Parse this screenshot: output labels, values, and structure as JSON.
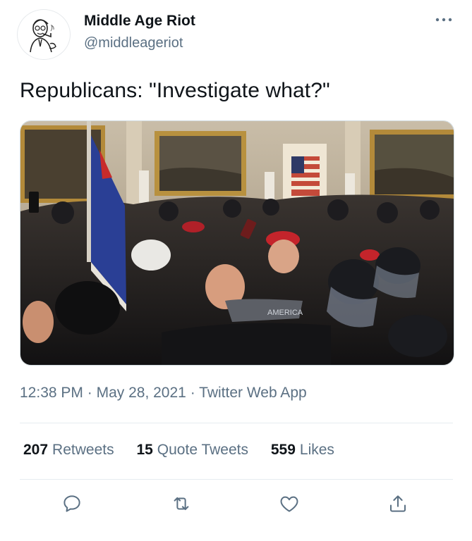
{
  "author": {
    "display_name": "Middle Age Riot",
    "handle": "@middleageriot",
    "avatar_icon": "cartoon-man-pipe-avatar"
  },
  "header": {
    "more_icon": "more-dots-icon"
  },
  "tweet": {
    "text": "Republicans: \"Investigate what?\""
  },
  "media": {
    "description_icon": "photo-image",
    "flag_text": "AMERICA"
  },
  "meta": {
    "time": "12:38 PM",
    "separator": "·",
    "date": "May 28, 2021",
    "source": "Twitter Web App"
  },
  "stats": {
    "retweets_count": "207",
    "retweets_label": "Retweets",
    "quotes_count": "15",
    "quotes_label": "Quote Tweets",
    "likes_count": "559",
    "likes_label": "Likes"
  },
  "actions": {
    "reply_icon": "reply-icon",
    "retweet_icon": "retweet-icon",
    "like_icon": "heart-icon",
    "share_icon": "share-icon"
  },
  "colors": {
    "text": "#0f1419",
    "secondary": "#5b7083",
    "accent": "#1da1f2",
    "divider": "#e6ecf0"
  }
}
